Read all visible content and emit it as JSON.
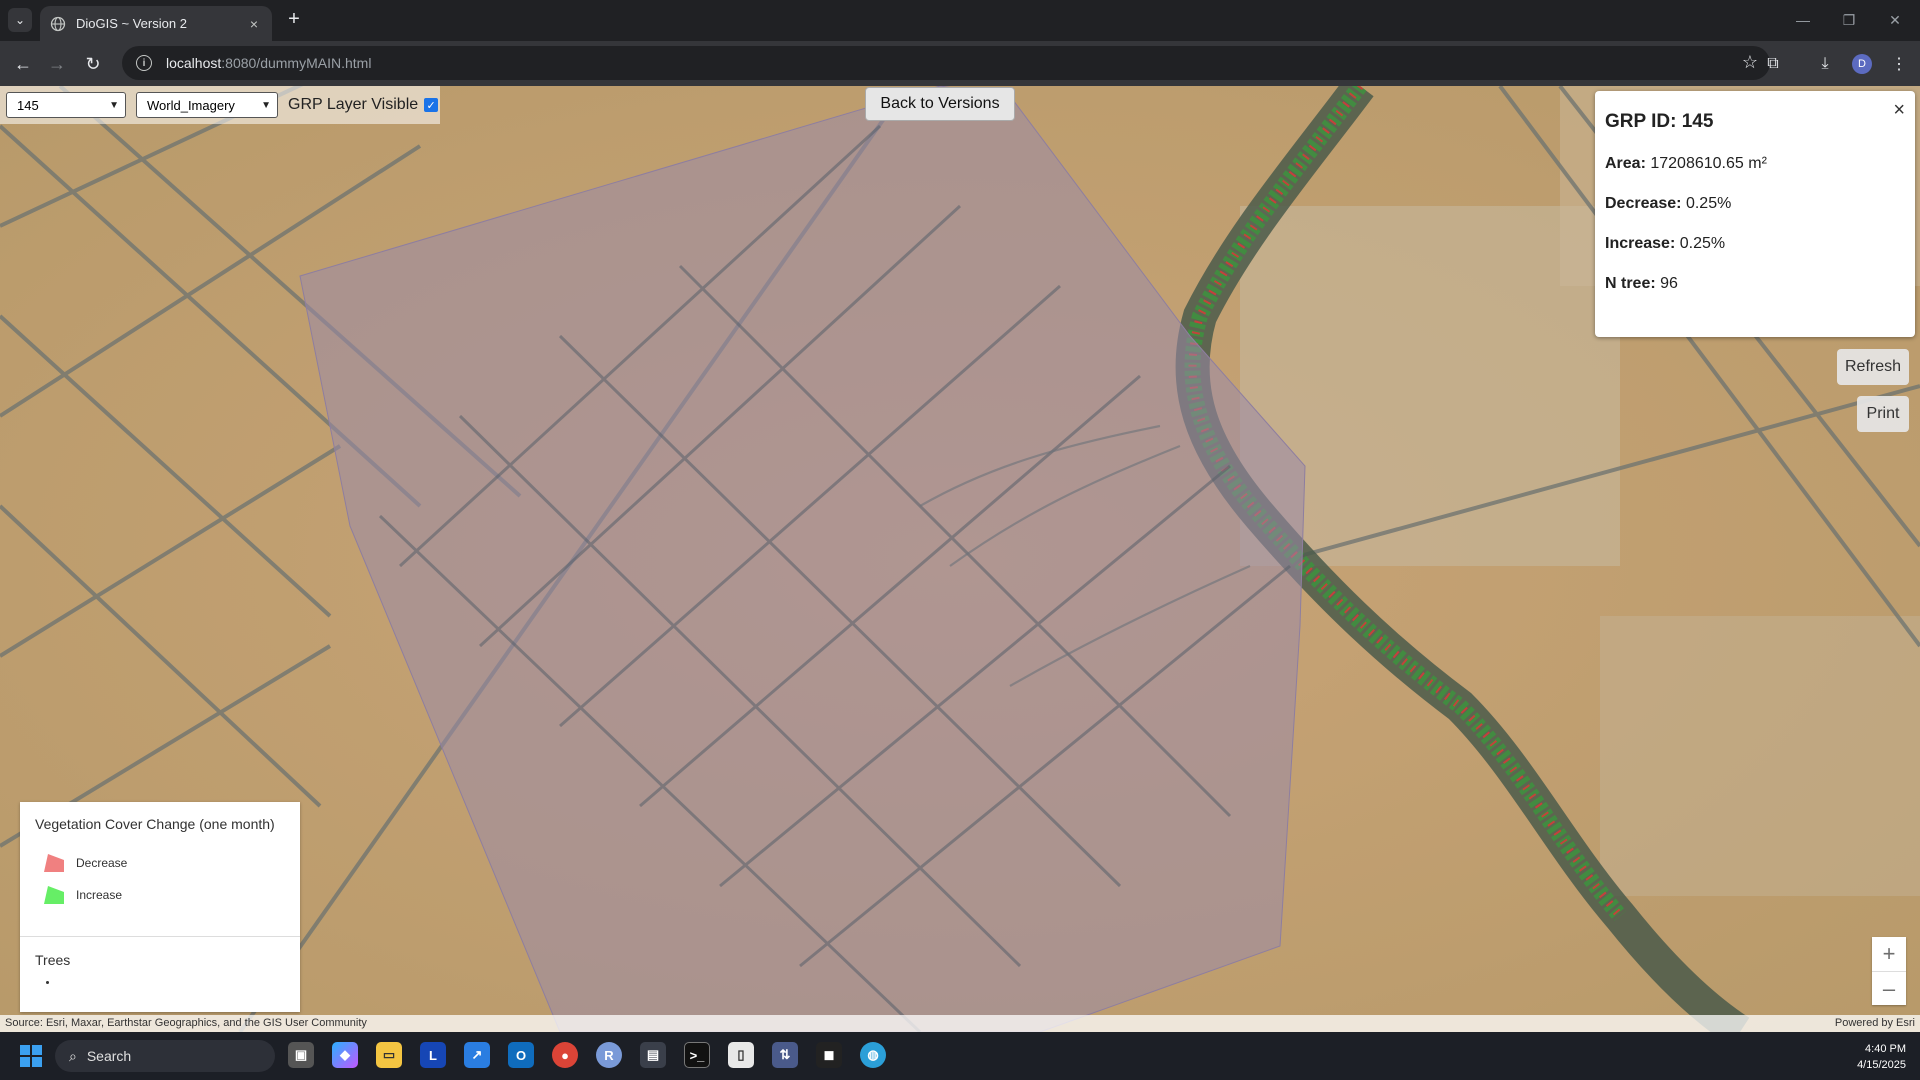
{
  "browser": {
    "tab_title": "DioGIS ~ Version 2",
    "tab_close": "×",
    "new_tab": "+",
    "url_host": "localhost",
    "url_path": ":8080/dummyMAIN.html",
    "profile_initial": "D"
  },
  "map": {
    "grp_select_value": "145",
    "basemap_select_value": "World_Imagery",
    "grp_layer_label": "GRP Layer Visible",
    "grp_layer_checked": true,
    "back_button": "Back to Versions",
    "refresh_button": "Refresh",
    "print_button": "Print",
    "zoom_in": "+",
    "zoom_out": "–",
    "attribution": "Source: Esri, Maxar, Earthstar Geographics, and the GIS User Community",
    "powered_by": "Powered by Esri"
  },
  "popup": {
    "title": "GRP ID: 145",
    "close": "×",
    "area_label": "Area:",
    "area_value": "17208610.65 m²",
    "decrease_label": "Decrease:",
    "decrease_value": "0.25%",
    "increase_label": "Increase:",
    "increase_value": "0.25%",
    "ntree_label": "N tree:",
    "ntree_value": "96"
  },
  "legend": {
    "title": "Vegetation Cover Change (one month)",
    "items": [
      {
        "label": "Decrease",
        "color": "#f08080"
      },
      {
        "label": "Increase",
        "color": "#66ee66"
      }
    ],
    "trees_title": "Trees"
  },
  "taskbar": {
    "search_label": "Search",
    "time": "4:40 PM",
    "date": "4/15/2025"
  },
  "colors": {
    "polygon_fill": "#9b8aa8",
    "decrease": "#f08080",
    "increase": "#66ee66",
    "accent": "#1a73e8"
  }
}
